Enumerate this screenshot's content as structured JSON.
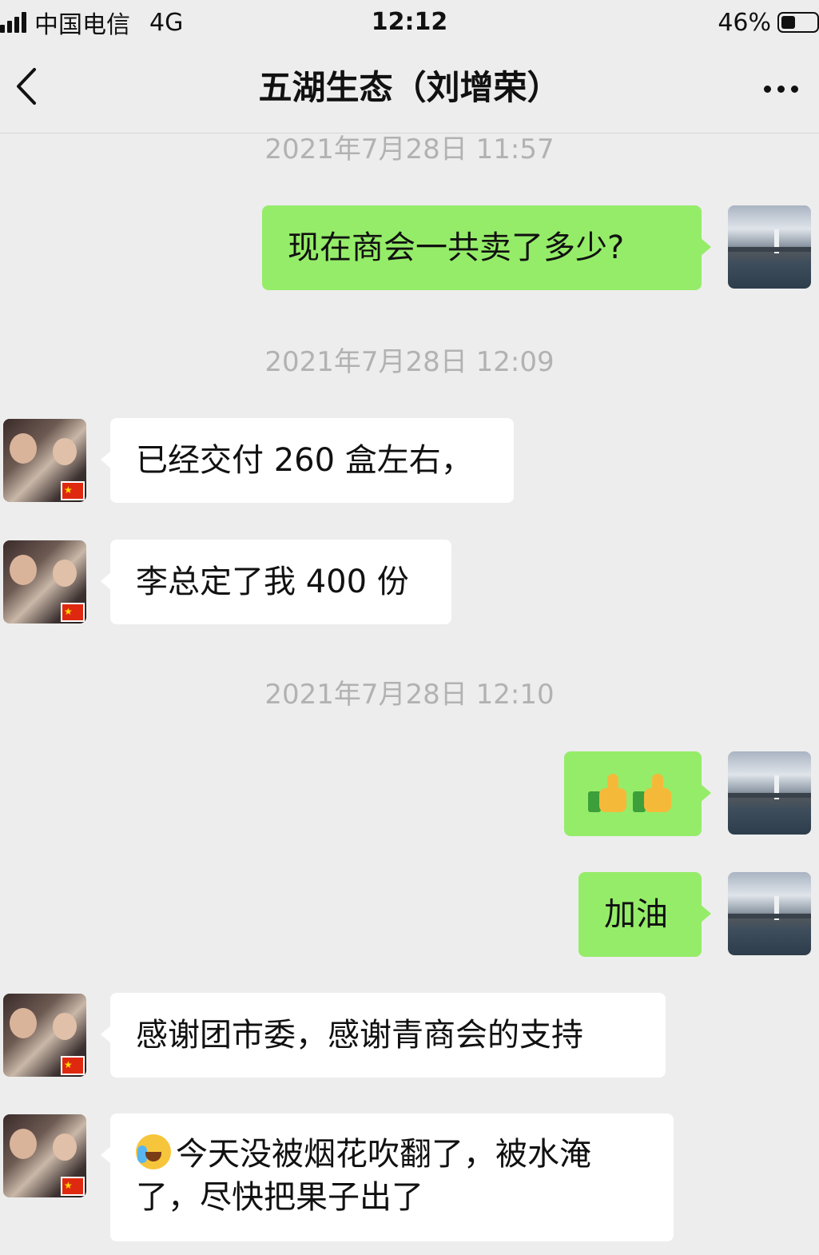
{
  "status_bar": {
    "carrier": "中国电信",
    "network": "4G",
    "time": "12:12",
    "battery": "46%"
  },
  "nav": {
    "title": "五湖生态（刘增荣）"
  },
  "icons": {
    "back": "chevron-left-icon",
    "more": "more-horizontal-icon",
    "thumbs_up": "thumbs-up-emoji",
    "crying": "crying-laughing-emoji"
  },
  "colors": {
    "sent_bubble": "#95ec69",
    "received_bubble": "#ffffff",
    "background": "#ededed",
    "timestamp": "#b2b2b2"
  },
  "messages": {
    "ts1": "2021年7月28日 11:57",
    "m1": "现在商会一共卖了多少?",
    "ts2": "2021年7月28日 12:09",
    "m2": "已经交付 260 盒左右，",
    "m3": "李总定了我 400 份",
    "ts3": "2021年7月28日 12:10",
    "m4": "👍👍",
    "m5": "加油",
    "m6": "感谢团市委，感谢青商会的支持",
    "m7_line1": "今天没被烟花吹翻了，被水淹",
    "m7_line2": "了，尽快把果子出了"
  }
}
